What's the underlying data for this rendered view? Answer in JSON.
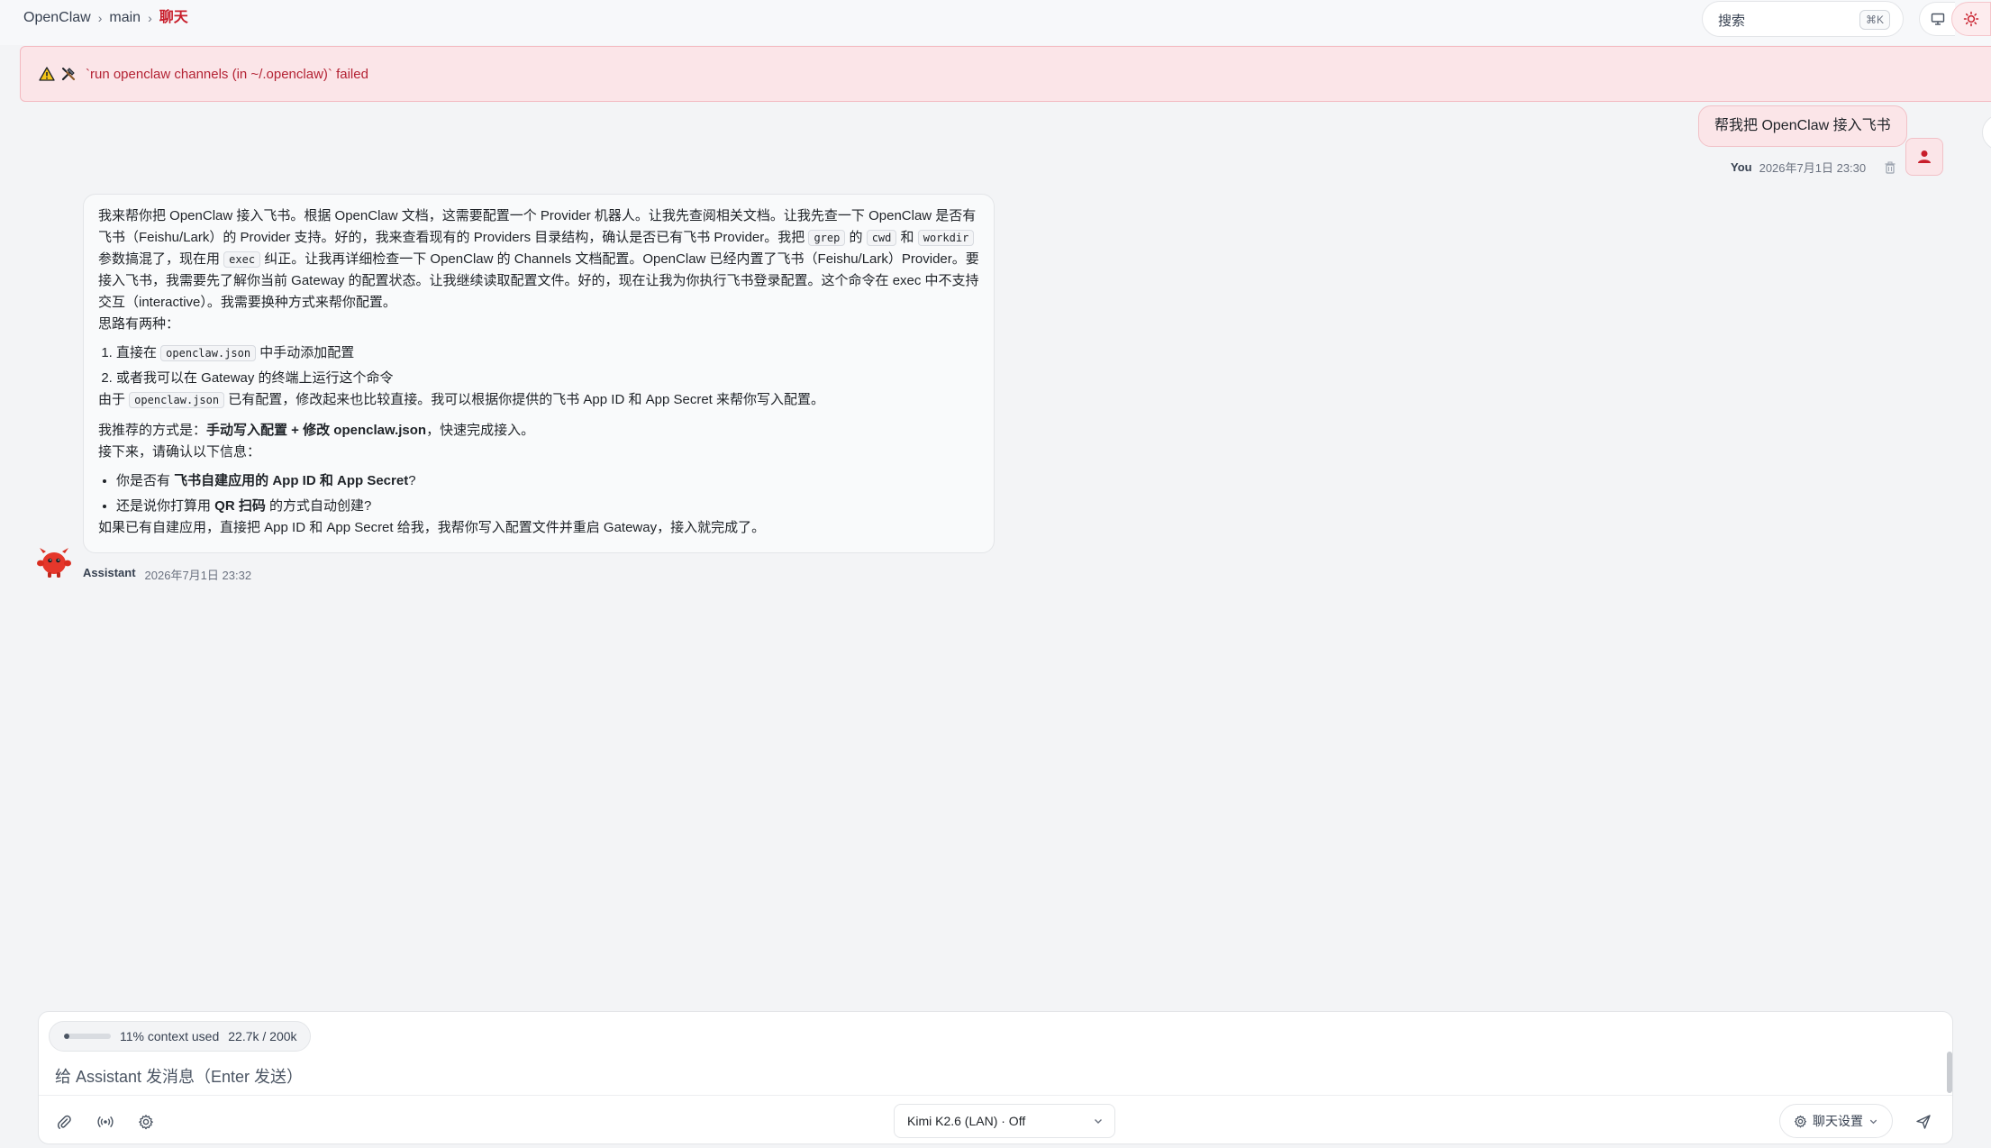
{
  "breadcrumb": {
    "app": "OpenClaw",
    "branch": "main",
    "current": "聊天"
  },
  "search": {
    "placeholder": "搜索",
    "shortcut": "⌘K"
  },
  "header_icons": [
    "monitor-icon",
    "sun-icon"
  ],
  "error_banner": {
    "text": "`run openclaw channels (in ~/.openclaw)` failed",
    "icons": [
      "warning-icon",
      "tools-icon"
    ]
  },
  "user_message": {
    "text": "帮我把 OpenClaw 接入飞书",
    "author": "You",
    "time": "2026年7月1日 23:30"
  },
  "assistant_message": {
    "author": "Assistant",
    "time": "2026年7月1日 23:32",
    "para1": {
      "a": "我来帮你把 OpenClaw 接入飞书。根据 OpenClaw 文档，这需要配置一个 Provider 机器人。让我先查阅相关文档。让我先查一下 OpenClaw 是否有飞书（Feishu/Lark）的 Provider 支持。好的，我来查看现有的 Providers 目录结构，确认是否已有飞书 Provider。我把 ",
      "code1": "grep",
      "b": " 的 ",
      "code2": "cwd",
      "c": " 和 ",
      "code3": "workdir",
      "d": " 参数搞混了，现在用 ",
      "code4": "exec",
      "e": " 纠正。让我再详细检查一下 OpenClaw 的 Channels 文档配置。OpenClaw 已经内置了飞书（Feishu/Lark）Provider。要接入飞书，我需要先了解你当前 Gateway 的配置状态。让我继续读取配置文件。好的，现在让我为你执行飞书登录配置。这个命令在 exec 中不支持交互（interactive）。我需要换种方式来帮你配置。"
    },
    "ideas_intro": "思路有两种：",
    "option1_pre": "直接在 ",
    "option1_code": "openclaw.json",
    "option1_post": " 中手动添加配置",
    "option2": "或者我可以在 Gateway 的终端上运行这个命令",
    "reason_pre": "由于 ",
    "reason_code": "openclaw.json",
    "reason_post": " 已有配置，修改起来也比较直接。我可以根据你提供的飞书 App ID 和 App Secret 来帮你写入配置。",
    "rec_pre": "我推荐的方式是：",
    "rec_bold": "手动写入配置 + 修改 openclaw.json",
    "rec_post": "，快速完成接入。",
    "next": "接下来，请确认以下信息：",
    "bullet1_pre": "你是否有 ",
    "bullet1_bold": "飞书自建应用的 App ID 和 App Secret",
    "bullet1_post": "?",
    "bullet2_pre": "还是说你打算用 ",
    "bullet2_bold": "QR 扫码",
    "bullet2_post": " 的方式自动创建?",
    "closing": "如果已有自建应用，直接把 App ID 和 App Secret 给我，我帮你写入配置文件并重启 Gateway，接入就完成了。"
  },
  "composer": {
    "context_label": "11% context used",
    "context_tokens": "22.7k / 200k",
    "context_fraction": 0.11,
    "placeholder": "给 Assistant 发消息（Enter 发送）",
    "model": "Kimi K2.6 (LAN) · Off",
    "settings_label": "聊天设置",
    "tool_icons": [
      "paperclip-icon",
      "broadcast-icon",
      "gear-icon"
    ],
    "send_icon": "send-icon"
  },
  "colors": {
    "accent": "#c81e2b",
    "error_bg": "#fbe5e8",
    "error_text": "#b42334",
    "page_bg": "#f3f4f6"
  }
}
